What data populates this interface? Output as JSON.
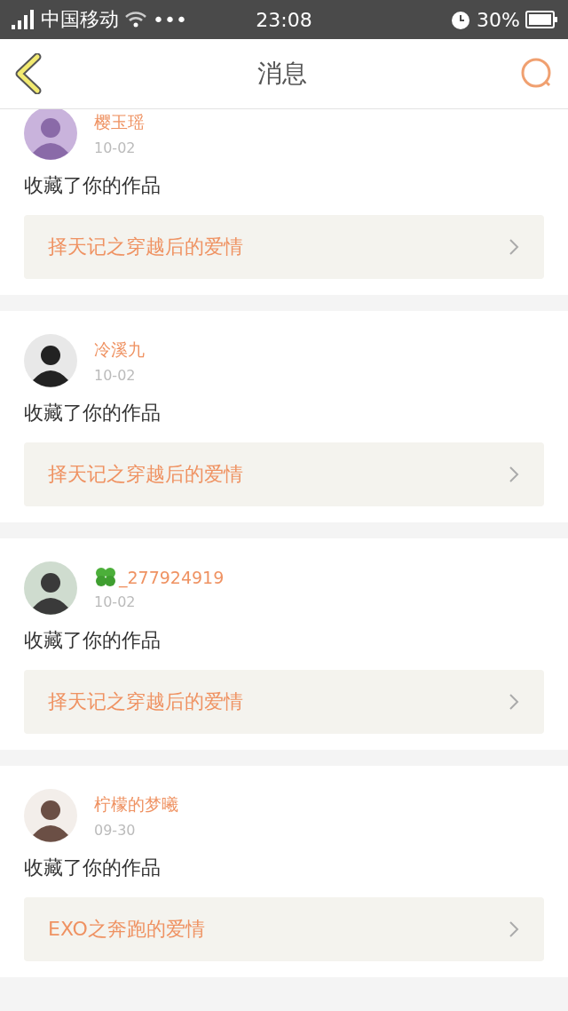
{
  "status_bar": {
    "carrier": "中国移动",
    "dots": "•••",
    "time": "23:08",
    "battery": "30%"
  },
  "header": {
    "title": "消息"
  },
  "messages": [
    {
      "name": "樱玉瑶",
      "clover": false,
      "date": "10-02",
      "action": "收藏了你的作品",
      "work": "择天记之穿越后的爱情"
    },
    {
      "name": "冷溪九",
      "clover": false,
      "date": "10-02",
      "action": "收藏了你的作品",
      "work": "择天记之穿越后的爱情"
    },
    {
      "name": "_277924919",
      "clover": true,
      "date": "10-02",
      "action": "收藏了你的作品",
      "work": "择天记之穿越后的爱情"
    },
    {
      "name": "柠檬的梦曦",
      "clover": false,
      "date": "09-30",
      "action": "收藏了你的作品",
      "work": "EXO之奔跑的爱情"
    }
  ]
}
